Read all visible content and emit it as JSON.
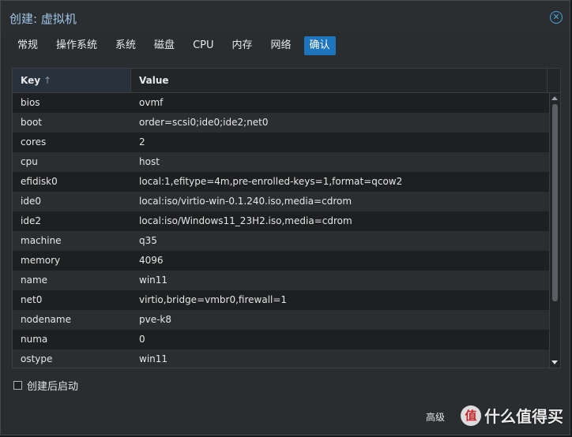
{
  "window": {
    "title": "创建: 虚拟机"
  },
  "tabs": [
    {
      "label": "常规",
      "active": false
    },
    {
      "label": "操作系统",
      "active": false
    },
    {
      "label": "系统",
      "active": false
    },
    {
      "label": "磁盘",
      "active": false
    },
    {
      "label": "CPU",
      "active": false
    },
    {
      "label": "内存",
      "active": false
    },
    {
      "label": "网络",
      "active": false
    },
    {
      "label": "确认",
      "active": true
    }
  ],
  "grid": {
    "columns": {
      "key": "Key",
      "value": "Value",
      "sort_indicator": "↑"
    },
    "rows": [
      {
        "key": "bios",
        "value": "ovmf"
      },
      {
        "key": "boot",
        "value": "order=scsi0;ide0;ide2;net0"
      },
      {
        "key": "cores",
        "value": "2"
      },
      {
        "key": "cpu",
        "value": "host"
      },
      {
        "key": "efidisk0",
        "value": "local:1,efitype=4m,pre-enrolled-keys=1,format=qcow2"
      },
      {
        "key": "ide0",
        "value": "local:iso/virtio-win-0.1.240.iso,media=cdrom"
      },
      {
        "key": "ide2",
        "value": "local:iso/Windows11_23H2.iso,media=cdrom"
      },
      {
        "key": "machine",
        "value": "q35"
      },
      {
        "key": "memory",
        "value": "4096"
      },
      {
        "key": "name",
        "value": "win11"
      },
      {
        "key": "net0",
        "value": "virtio,bridge=vmbr0,firewall=1"
      },
      {
        "key": "nodename",
        "value": "pve-k8"
      },
      {
        "key": "numa",
        "value": "0"
      },
      {
        "key": "ostype",
        "value": "win11"
      }
    ]
  },
  "start_after_create": {
    "label": "创建后启动",
    "checked": false
  },
  "footer": {
    "advanced_label": "高级"
  },
  "watermark": {
    "icon_text": "值",
    "text": "什么值得买"
  },
  "colors": {
    "accent": "#1e74bd",
    "title": "#9ec4e6",
    "background": "#2a2d30"
  }
}
